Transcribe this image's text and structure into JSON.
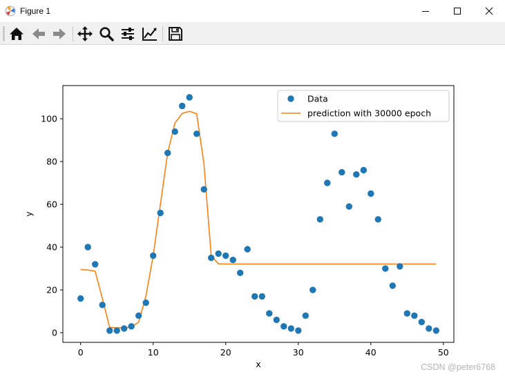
{
  "window": {
    "title": "Figure 1",
    "controls": [
      "minimize",
      "maximize",
      "close"
    ]
  },
  "toolbar": {
    "buttons": [
      "home-icon",
      "back-arrow-icon",
      "forward-arrow-icon",
      "pan-move-icon",
      "zoom-magnifier-icon",
      "subplots-sliders-icon",
      "edit-axis-curve-icon",
      "save-floppy-icon"
    ]
  },
  "watermark": "CSDN @peter6768",
  "chart_data": {
    "type": "scatter",
    "xlabel": "x",
    "ylabel": "y",
    "xlim": [
      -2.45,
      51.45
    ],
    "ylim": [
      -4.5,
      115.5
    ],
    "xticks": [
      0,
      10,
      20,
      30,
      40,
      50
    ],
    "yticks": [
      0,
      20,
      40,
      60,
      80,
      100
    ],
    "grid": false,
    "legend_position": "upper-right",
    "series": [
      {
        "name": "Data",
        "kind": "scatter",
        "color": "#1f77b4",
        "x": [
          0,
          1,
          2,
          3,
          4,
          5,
          6,
          7,
          8,
          9,
          10,
          11,
          12,
          13,
          14,
          15,
          16,
          17,
          18,
          19,
          20,
          21,
          22,
          23,
          24,
          25,
          26,
          27,
          28,
          29,
          30,
          31,
          32,
          33,
          34,
          35,
          36,
          37,
          38,
          39,
          40,
          41,
          42,
          43,
          44,
          45,
          46,
          47,
          48,
          49
        ],
        "y": [
          16,
          40,
          32,
          13,
          1,
          1,
          2,
          3,
          8,
          14,
          36,
          56,
          84,
          94,
          106,
          110,
          93,
          67,
          35,
          37,
          36,
          34,
          28,
          39,
          17,
          17,
          9,
          6,
          3,
          2,
          1,
          8,
          20,
          53,
          70,
          93,
          75,
          59,
          74,
          76,
          65,
          53,
          30,
          22,
          31,
          9,
          8,
          5,
          2,
          1
        ]
      },
      {
        "name": "prediction with 30000 epoch",
        "kind": "line",
        "color": "#ff7f0e",
        "x": [
          0,
          1,
          2,
          3,
          4,
          5,
          6,
          7,
          8,
          9,
          10,
          11,
          12,
          13,
          14,
          15,
          16,
          17,
          18,
          19,
          20,
          21,
          22,
          23,
          24,
          25,
          26,
          27,
          28,
          29,
          30,
          31,
          32,
          33,
          34,
          35,
          36,
          37,
          38,
          39,
          40,
          41,
          42,
          43,
          44,
          45,
          46,
          47,
          48,
          49
        ],
        "y": [
          29.5,
          29.3,
          28.8,
          16,
          2.5,
          2.3,
          2.3,
          2.6,
          5,
          17,
          36,
          60,
          84,
          98,
          102.5,
          103.5,
          102.3,
          79,
          36,
          32.2,
          32.1,
          32.1,
          32.1,
          32.1,
          32.1,
          32.1,
          32.1,
          32.1,
          32.1,
          32.1,
          32.1,
          32.1,
          32.1,
          32.1,
          32.1,
          32.1,
          32.1,
          32.1,
          32.1,
          32.1,
          32.1,
          32.1,
          32.1,
          32.1,
          32.1,
          32.1,
          32.1,
          32.1,
          32.1,
          32.1
        ]
      }
    ]
  }
}
